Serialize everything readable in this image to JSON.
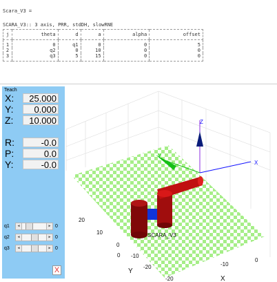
{
  "console": {
    "var_line": "Scara_V3 =",
    "desc_line": "SCARA_V3:: 3 axis, PRR, stdDH, slowRNE",
    "dh_headers": [
      "j",
      "theta",
      "d",
      "a",
      "alpha",
      "offset"
    ],
    "dh_rows": [
      [
        "1",
        "0",
        "q1",
        "0",
        "0",
        "5"
      ],
      [
        "2",
        "q2",
        "0",
        "10",
        "0",
        "0"
      ],
      [
        "3",
        "q3",
        "5",
        "15",
        "0",
        "0"
      ]
    ]
  },
  "teach": {
    "title": "Teach",
    "pose": [
      {
        "label": "X:",
        "value": "25.000"
      },
      {
        "label": "Y:",
        "value": "0.000"
      },
      {
        "label": "Z:",
        "value": "10.000"
      },
      {
        "label": "R:",
        "value": "-0.0"
      },
      {
        "label": "P:",
        "value": "0.0"
      },
      {
        "label": "Y:",
        "value": "-0.0"
      }
    ],
    "joints": [
      {
        "label": "q1",
        "value": "0",
        "level": 0.2
      },
      {
        "label": "q2",
        "value": "0",
        "level": 0.5
      },
      {
        "label": "q3",
        "value": "0",
        "level": 0.5
      }
    ],
    "close_glyph": "X"
  },
  "plot": {
    "robot_label": "SCARA_V3",
    "axes": {
      "x": "X",
      "y": "Y",
      "z": "Z"
    },
    "x_ticks": [
      "20",
      "10",
      "0"
    ],
    "y_ticks": [
      "0",
      "-10",
      "-20"
    ],
    "xr_ticks": [
      "-20",
      "-10",
      "0"
    ],
    "colors": {
      "floor_a": "#a6ee88",
      "floor_b": "#ffffff",
      "link": "#c01010",
      "base": "#800808",
      "joint": "#1234d8",
      "z_arrow": "#0a1d7a",
      "y_arrow": "#16c016",
      "x_axis": "#1010ff"
    }
  }
}
